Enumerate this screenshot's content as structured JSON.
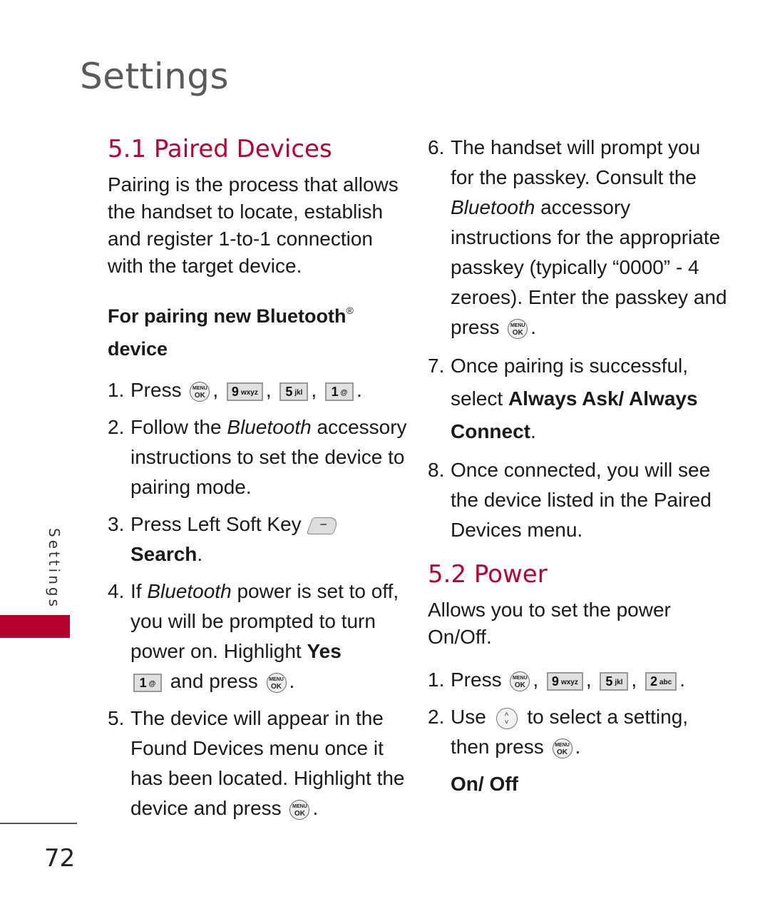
{
  "page": {
    "title": "Settings",
    "side_label": "Settings",
    "page_number": "72",
    "accent_color": "#c1002f",
    "tab_color": "#b5002e"
  },
  "paired_devices": {
    "heading": "5.1 Paired Devices",
    "intro": "Pairing is the process that allows the handset to locate, establish and register 1-to-1 connection with the target device.",
    "subheading": "For pairing new Bluetooth",
    "subheading_mark": "®",
    "subheading_end": "device",
    "steps": [
      {
        "num": "1.",
        "text": "Press",
        "keys": [
          "MENU/OK",
          "9 wxyz",
          "5 jkl",
          "1 @"
        ]
      },
      {
        "num": "2.",
        "pre": "Follow the ",
        "italic": "Bluetooth",
        "post": " accessory instructions to set the device to pairing mode."
      },
      {
        "num": "3.",
        "pre": "Press Left Soft Key",
        "bold": "Search",
        "post": "."
      },
      {
        "num": "4.",
        "pre": "If ",
        "italic": "Bluetooth",
        "mid": " power is set to off, you will be prompted to turn power on. Highlight ",
        "bold": "Yes",
        "post": " and press"
      },
      {
        "num": "5.",
        "pre": "The device will appear in the Found Devices menu once it has been located. Highlight the device and press"
      },
      {
        "num": "6.",
        "pre": "The handset will prompt you for the passkey. Consult the ",
        "italic": "Bluetooth",
        "post": " accessory instructions for the appropriate passkey (typically “0000” - 4 zeroes). Enter the passkey and press"
      },
      {
        "num": "7.",
        "pre": "Once pairing is successful, select ",
        "bold": "Always Ask/ Always Connect",
        "post": "."
      },
      {
        "num": "8.",
        "pre": "Once connected, you will see the device listed in the Paired Devices menu."
      }
    ]
  },
  "power": {
    "heading": "5.2 Power",
    "intro": "Allows you to set the power On/Off.",
    "steps": [
      {
        "num": "1.",
        "text": "Press",
        "keys": [
          "MENU/OK",
          "9 wxyz",
          "5 jkl",
          "2 abc"
        ]
      },
      {
        "num": "2.",
        "pre": "Use",
        "post": "to select a setting, then press"
      }
    ],
    "options": "On/ Off"
  },
  "keys": {
    "menu_top": "MENU",
    "menu_bottom": "OK",
    "k9": "9",
    "k9_sub": "wxyz",
    "k5": "5",
    "k5_sub": "jkl",
    "k1": "1",
    "k1_sub": "@",
    "k2": "2",
    "k2_sub": "abc",
    "softkey_glyph": "−",
    "nav_up": "˄",
    "nav_down": "˅",
    "comma": ",",
    "period": "."
  }
}
